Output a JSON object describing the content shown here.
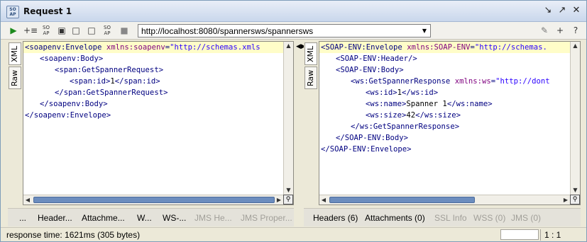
{
  "window": {
    "title": "Request 1",
    "logo_text": "SO\nAP"
  },
  "toolbar": {
    "url": "http://localhost:8080/spannersws/spannersws"
  },
  "request": {
    "tabs": [
      "XML",
      "Raw"
    ],
    "lines": [
      {
        "indent": 0,
        "parts": [
          [
            "tag",
            "<soapenv:Envelope "
          ],
          [
            "attr",
            "xmlns:soapenv"
          ],
          [
            "tag",
            "="
          ],
          [
            "val",
            "\"http://schemas.xmls"
          ]
        ]
      },
      {
        "indent": 1,
        "parts": [
          [
            "tag",
            "<soapenv:Body>"
          ]
        ]
      },
      {
        "indent": 2,
        "parts": [
          [
            "tag",
            "<span:GetSpannerRequest>"
          ]
        ]
      },
      {
        "indent": 3,
        "parts": [
          [
            "tag",
            "<span:id>"
          ],
          [
            "txt",
            "1"
          ],
          [
            "tag",
            "</span:id>"
          ]
        ]
      },
      {
        "indent": 2,
        "parts": [
          [
            "tag",
            "</span:GetSpannerRequest>"
          ]
        ]
      },
      {
        "indent": 1,
        "parts": [
          [
            "tag",
            "</soapenv:Body>"
          ]
        ]
      },
      {
        "indent": 0,
        "parts": [
          [
            "tag",
            "</soapenv:Envelope>"
          ]
        ]
      }
    ],
    "bottom_tabs": [
      "...",
      "Header...",
      "Attachme...",
      "W...",
      "WS-...",
      "JMS He...",
      "JMS Proper..."
    ]
  },
  "response": {
    "tabs": [
      "XML",
      "Raw"
    ],
    "lines": [
      {
        "indent": 0,
        "parts": [
          [
            "tag",
            "<SOAP-ENV:Envelope "
          ],
          [
            "attr",
            "xmlns:SOAP-ENV"
          ],
          [
            "tag",
            "="
          ],
          [
            "val",
            "\"http://schemas."
          ]
        ]
      },
      {
        "indent": 1,
        "parts": [
          [
            "tag",
            "<SOAP-ENV:Header/>"
          ]
        ]
      },
      {
        "indent": 1,
        "parts": [
          [
            "tag",
            "<SOAP-ENV:Body>"
          ]
        ]
      },
      {
        "indent": 2,
        "parts": [
          [
            "tag",
            "<ws:GetSpannerResponse "
          ],
          [
            "attr",
            "xmlns:ws"
          ],
          [
            "tag",
            "="
          ],
          [
            "val",
            "\"http://dont"
          ]
        ]
      },
      {
        "indent": 3,
        "parts": [
          [
            "tag",
            "<ws:id>"
          ],
          [
            "txt",
            "1"
          ],
          [
            "tag",
            "</ws:id>"
          ]
        ]
      },
      {
        "indent": 3,
        "parts": [
          [
            "tag",
            "<ws:name>"
          ],
          [
            "txt",
            "Spanner 1"
          ],
          [
            "tag",
            "</ws:name>"
          ]
        ]
      },
      {
        "indent": 3,
        "parts": [
          [
            "tag",
            "<ws:size>"
          ],
          [
            "txt",
            "42"
          ],
          [
            "tag",
            "</ws:size>"
          ]
        ]
      },
      {
        "indent": 2,
        "parts": [
          [
            "tag",
            "</ws:GetSpannerResponse>"
          ]
        ]
      },
      {
        "indent": 1,
        "parts": [
          [
            "tag",
            "</SOAP-ENV:Body>"
          ]
        ]
      },
      {
        "indent": 0,
        "parts": [
          [
            "tag",
            "</SOAP-ENV:Envelope>"
          ]
        ]
      }
    ],
    "bottom_tabs": [
      "Headers (6)",
      "Attachments (0)",
      "SSL Info",
      "WSS (0)",
      "JMS (0)"
    ]
  },
  "status": {
    "text": "response time: 1621ms (305 bytes)",
    "position": "1 : 1"
  },
  "colors": {
    "accent": "#6c8dbe",
    "tag": "#000080",
    "attr": "#7f007f",
    "value": "#2a00ff"
  }
}
